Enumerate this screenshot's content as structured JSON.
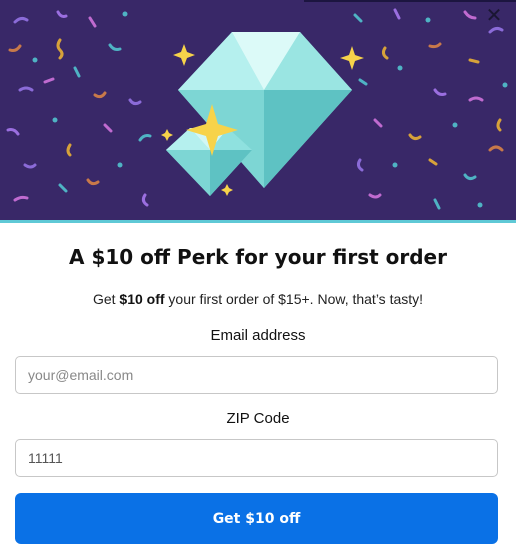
{
  "modal": {
    "close_glyph": "✕",
    "title": "A $10 off Perk for your first order",
    "subtitle_prefix": "Get ",
    "subtitle_bold": "$10 off",
    "subtitle_suffix": " your first order of $15+. Now, that’s tasty!"
  },
  "form": {
    "email_label": "Email address",
    "email_placeholder": "your@email.com",
    "email_value": "",
    "zip_label": "ZIP Code",
    "zip_value": "11111",
    "submit_label": "Get $10 off"
  },
  "colors": {
    "hero_background": "#392868",
    "accent_line": "#5fc9d6",
    "button": "#0a71e6",
    "gem": "#8ee3e0",
    "sparkle": "#f7d34a"
  },
  "icons": {
    "close": "close-icon",
    "hero_art": "diamond-gems-illustration"
  }
}
